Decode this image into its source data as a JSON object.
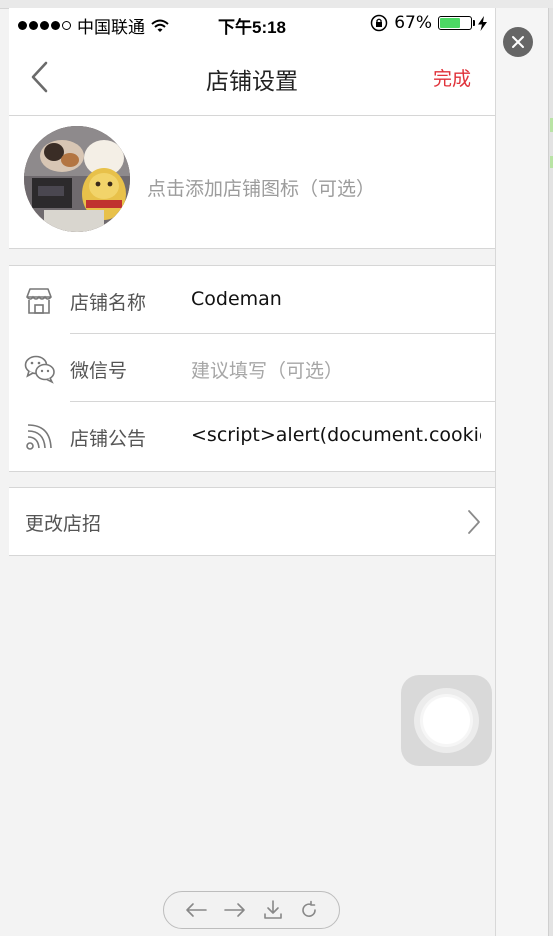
{
  "status_bar": {
    "carrier": "中国联通",
    "time": "下午5:18",
    "battery": "67%",
    "battery_level": 0.67,
    "icons": [
      "signal-dots-icon",
      "wifi-icon",
      "orientation-lock-icon",
      "battery-icon",
      "charging-bolt-icon"
    ]
  },
  "nav": {
    "title": "店铺设置",
    "done_label": "完成",
    "back_icon": "chevron-left-icon"
  },
  "avatar_row": {
    "hint": "点击添加店铺图标（可选）"
  },
  "fields": [
    {
      "icon": "storefront-icon",
      "label": "店铺名称",
      "value": "Codeman",
      "placeholder": ""
    },
    {
      "icon": "wechat-icon",
      "label": "微信号",
      "value": "",
      "placeholder": "建议填写（可选）"
    },
    {
      "icon": "rss-icon",
      "label": "店铺公告",
      "value": "<script>alert(document.cookie)",
      "placeholder": ""
    }
  ],
  "sign_row": {
    "label": "更改店招",
    "icon": "chevron-right-icon"
  },
  "assistive_touch": {
    "icon": "assistive-touch-icon"
  },
  "browser_toolbar": {
    "icons": [
      "back-arrow-icon",
      "forward-arrow-icon",
      "download-icon",
      "refresh-icon"
    ]
  },
  "colors": {
    "accent": "#e0323a",
    "battery_fill": "#4cd964",
    "background": "#f3f3f3"
  }
}
